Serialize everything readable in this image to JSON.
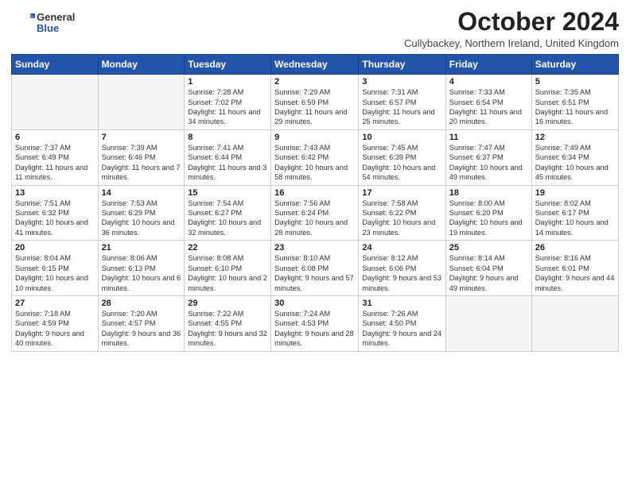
{
  "logo": {
    "general": "General",
    "blue": "Blue"
  },
  "title": "October 2024",
  "subtitle": "Cullybackey, Northern Ireland, United Kingdom",
  "days_of_week": [
    "Sunday",
    "Monday",
    "Tuesday",
    "Wednesday",
    "Thursday",
    "Friday",
    "Saturday"
  ],
  "weeks": [
    [
      {
        "day": "",
        "info": ""
      },
      {
        "day": "",
        "info": ""
      },
      {
        "day": "1",
        "info": "Sunrise: 7:28 AM\nSunset: 7:02 PM\nDaylight: 11 hours and 34 minutes."
      },
      {
        "day": "2",
        "info": "Sunrise: 7:29 AM\nSunset: 6:59 PM\nDaylight: 11 hours and 29 minutes."
      },
      {
        "day": "3",
        "info": "Sunrise: 7:31 AM\nSunset: 6:57 PM\nDaylight: 11 hours and 25 minutes."
      },
      {
        "day": "4",
        "info": "Sunrise: 7:33 AM\nSunset: 6:54 PM\nDaylight: 11 hours and 20 minutes."
      },
      {
        "day": "5",
        "info": "Sunrise: 7:35 AM\nSunset: 6:51 PM\nDaylight: 11 hours and 16 minutes."
      }
    ],
    [
      {
        "day": "6",
        "info": "Sunrise: 7:37 AM\nSunset: 6:49 PM\nDaylight: 11 hours and 11 minutes."
      },
      {
        "day": "7",
        "info": "Sunrise: 7:39 AM\nSunset: 6:46 PM\nDaylight: 11 hours and 7 minutes."
      },
      {
        "day": "8",
        "info": "Sunrise: 7:41 AM\nSunset: 6:44 PM\nDaylight: 11 hours and 3 minutes."
      },
      {
        "day": "9",
        "info": "Sunrise: 7:43 AM\nSunset: 6:42 PM\nDaylight: 10 hours and 58 minutes."
      },
      {
        "day": "10",
        "info": "Sunrise: 7:45 AM\nSunset: 6:39 PM\nDaylight: 10 hours and 54 minutes."
      },
      {
        "day": "11",
        "info": "Sunrise: 7:47 AM\nSunset: 6:37 PM\nDaylight: 10 hours and 49 minutes."
      },
      {
        "day": "12",
        "info": "Sunrise: 7:49 AM\nSunset: 6:34 PM\nDaylight: 10 hours and 45 minutes."
      }
    ],
    [
      {
        "day": "13",
        "info": "Sunrise: 7:51 AM\nSunset: 6:32 PM\nDaylight: 10 hours and 41 minutes."
      },
      {
        "day": "14",
        "info": "Sunrise: 7:53 AM\nSunset: 6:29 PM\nDaylight: 10 hours and 36 minutes."
      },
      {
        "day": "15",
        "info": "Sunrise: 7:54 AM\nSunset: 6:27 PM\nDaylight: 10 hours and 32 minutes."
      },
      {
        "day": "16",
        "info": "Sunrise: 7:56 AM\nSunset: 6:24 PM\nDaylight: 10 hours and 28 minutes."
      },
      {
        "day": "17",
        "info": "Sunrise: 7:58 AM\nSunset: 6:22 PM\nDaylight: 10 hours and 23 minutes."
      },
      {
        "day": "18",
        "info": "Sunrise: 8:00 AM\nSunset: 6:20 PM\nDaylight: 10 hours and 19 minutes."
      },
      {
        "day": "19",
        "info": "Sunrise: 8:02 AM\nSunset: 6:17 PM\nDaylight: 10 hours and 14 minutes."
      }
    ],
    [
      {
        "day": "20",
        "info": "Sunrise: 8:04 AM\nSunset: 6:15 PM\nDaylight: 10 hours and 10 minutes."
      },
      {
        "day": "21",
        "info": "Sunrise: 8:06 AM\nSunset: 6:13 PM\nDaylight: 10 hours and 6 minutes."
      },
      {
        "day": "22",
        "info": "Sunrise: 8:08 AM\nSunset: 6:10 PM\nDaylight: 10 hours and 2 minutes."
      },
      {
        "day": "23",
        "info": "Sunrise: 8:10 AM\nSunset: 6:08 PM\nDaylight: 9 hours and 57 minutes."
      },
      {
        "day": "24",
        "info": "Sunrise: 8:12 AM\nSunset: 6:06 PM\nDaylight: 9 hours and 53 minutes."
      },
      {
        "day": "25",
        "info": "Sunrise: 8:14 AM\nSunset: 6:04 PM\nDaylight: 9 hours and 49 minutes."
      },
      {
        "day": "26",
        "info": "Sunrise: 8:16 AM\nSunset: 6:01 PM\nDaylight: 9 hours and 44 minutes."
      }
    ],
    [
      {
        "day": "27",
        "info": "Sunrise: 7:18 AM\nSunset: 4:59 PM\nDaylight: 9 hours and 40 minutes."
      },
      {
        "day": "28",
        "info": "Sunrise: 7:20 AM\nSunset: 4:57 PM\nDaylight: 9 hours and 36 minutes."
      },
      {
        "day": "29",
        "info": "Sunrise: 7:22 AM\nSunset: 4:55 PM\nDaylight: 9 hours and 32 minutes."
      },
      {
        "day": "30",
        "info": "Sunrise: 7:24 AM\nSunset: 4:53 PM\nDaylight: 9 hours and 28 minutes."
      },
      {
        "day": "31",
        "info": "Sunrise: 7:26 AM\nSunset: 4:50 PM\nDaylight: 9 hours and 24 minutes."
      },
      {
        "day": "",
        "info": ""
      },
      {
        "day": "",
        "info": ""
      }
    ]
  ]
}
